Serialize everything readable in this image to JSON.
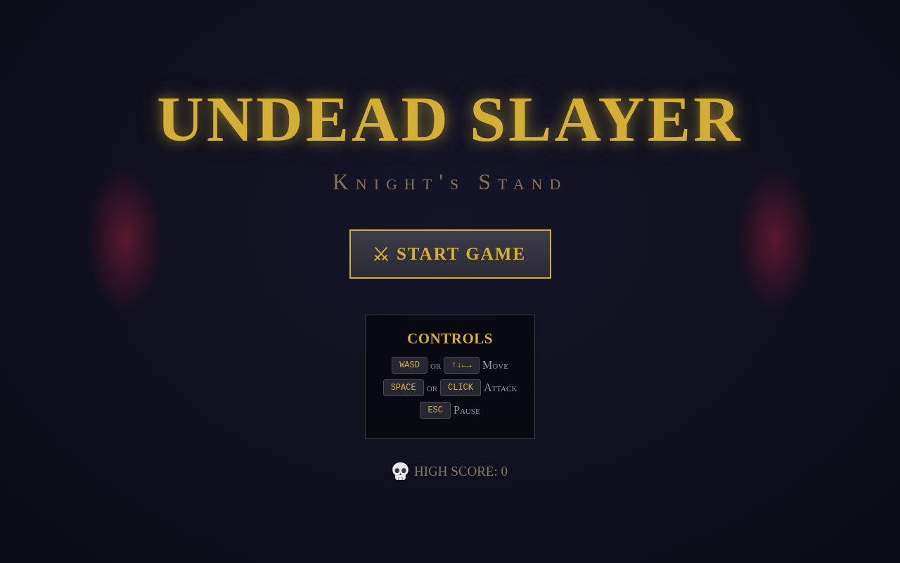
{
  "title": "UNDEAD SLAYER",
  "subtitle": "Knight's Stand",
  "start_button": {
    "label": "START GAME"
  },
  "controls": {
    "title": "CONTROLS",
    "rows": [
      {
        "keys": [
          "WASD",
          "↑↓←→"
        ],
        "joiner": "or",
        "action": "Move"
      },
      {
        "keys": [
          "SPACE",
          "CLICK"
        ],
        "joiner": "or",
        "action": "Attack"
      },
      {
        "keys": [
          "ESC"
        ],
        "action": "Pause"
      }
    ]
  },
  "high_score": {
    "label": "HIGH SCORE: 0"
  }
}
